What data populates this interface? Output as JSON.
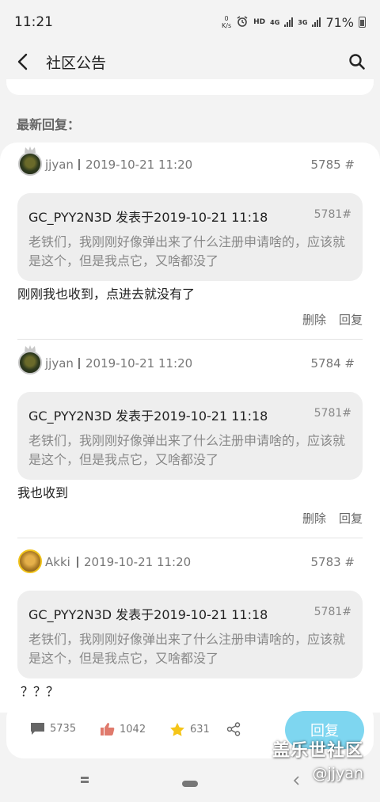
{
  "status_bar": {
    "time": "11:21",
    "network_speed_top": "0",
    "network_speed_unit": "K/s",
    "hd_label": "HD",
    "net_4g": "4G",
    "net_3g": "3G",
    "battery": "71%"
  },
  "header": {
    "title": "社区公告"
  },
  "section_label": "最新回复：",
  "replies": [
    {
      "username": "jjyan",
      "datetime": "2019-10-21 11:20",
      "floor": "5785 #",
      "quote": {
        "author_line": "GC_PYY2N3D 发表于2019-10-21 11:18",
        "floor": "5781#",
        "text": "老铁们，我刚刚好像弹出来了什么注册申请啥的，应该就是这个，但是我点它，又啥都没了"
      },
      "body": "刚刚我也收到，点进去就没有了",
      "delete_label": "删除",
      "reply_label": "回复"
    },
    {
      "username": "jjyan",
      "datetime": "2019-10-21 11:20",
      "floor": "5784 #",
      "quote": {
        "author_line": "GC_PYY2N3D 发表于2019-10-21 11:18",
        "floor": "5781#",
        "text": "老铁们，我刚刚好像弹出来了什么注册申请啥的，应该就是这个，但是我点它，又啥都没了"
      },
      "body": "我也收到",
      "delete_label": "删除",
      "reply_label": "回复"
    },
    {
      "username": "Akki",
      "datetime": "2019-10-21 11:20",
      "floor": "5783 #",
      "quote": {
        "author_line": "GC_PYY2N3D 发表于2019-10-21 11:18",
        "floor": "5781#",
        "text": "老铁们，我刚刚好像弹出来了什么注册申请啥的，应该就是这个，但是我点它，又啥都没了"
      },
      "body": "？？？"
    }
  ],
  "bottom_bar": {
    "comments": "5735",
    "likes": "1042",
    "favorites": "631",
    "reply_button": "回复"
  },
  "watermark": {
    "line1": "盖乐世社区",
    "line2": "@jjyan"
  },
  "colors": {
    "accent": "#7ed6f0",
    "like": "#e07a6c",
    "star": "#f5c518",
    "card": "#ffffff",
    "quote_bg": "#eeeeee",
    "page_bg": "#f3f3f3"
  },
  "icons": [
    "back-arrow-icon",
    "search-icon",
    "comment-icon",
    "thumbs-up-icon",
    "star-icon",
    "share-icon",
    "recent-apps-icon",
    "home-icon",
    "nav-back-icon"
  ]
}
